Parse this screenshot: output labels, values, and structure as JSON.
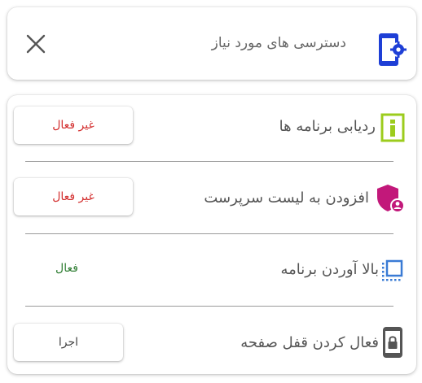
{
  "header": {
    "title": "دسترسی های مورد نیاز",
    "icon": "phone-settings-icon",
    "close_icon": "close-icon"
  },
  "permissions": [
    {
      "label": "ردیابی برنامه ها",
      "icon": "info-icon",
      "status": "غیر فعال",
      "status_color": "#d32f2f"
    },
    {
      "label": "افزودن به لیست سرپرست",
      "icon": "shield-user-icon",
      "status": "غیر فعال",
      "status_color": "#d32f2f"
    },
    {
      "label": "بالا آوردن برنامه",
      "icon": "overlay-window-icon",
      "status": "فعال",
      "status_color": "#2e7d32"
    },
    {
      "label": "فعال کردن قفل صفحه",
      "icon": "phone-lock-icon",
      "status": "اجرا",
      "status_color": "#444444"
    }
  ],
  "colors": {
    "accent_blue": "#1e3fd6",
    "info_green": "#9ccc1d",
    "shield_magenta": "#c2187a",
    "overlay_blue": "#3a7bd5",
    "lock_gray": "#555555"
  }
}
